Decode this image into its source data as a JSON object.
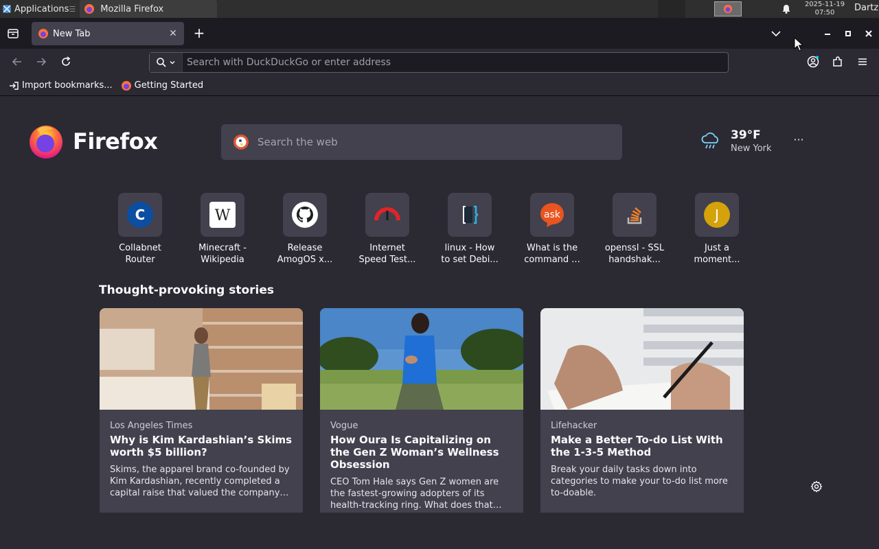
{
  "taskbar": {
    "applications_label": "Applications",
    "separator": "☰",
    "window_title": "Mozilla Firefox",
    "clock_date": "2025-11-19",
    "clock_time": "07:50",
    "user": "Dartz"
  },
  "tabs": [
    {
      "label": "New Tab",
      "active": true
    }
  ],
  "navbar": {
    "url_placeholder": "Search with DuckDuckGo or enter address"
  },
  "bookmarks": [
    {
      "label": "Import bookmarks..."
    },
    {
      "label": "Getting Started"
    }
  ],
  "newtab": {
    "brand": "Firefox",
    "search_placeholder": "Search the web",
    "weather": {
      "temp": "39°F",
      "city": "New York"
    },
    "shortcuts": [
      {
        "line1": "Collabnet",
        "line2": "Router",
        "icon": "collabnet-c-icon"
      },
      {
        "line1": "Minecraft -",
        "line2": "Wikipedia",
        "icon": "wikipedia-w-icon"
      },
      {
        "line1": "Release",
        "line2": "AmogOS x...",
        "icon": "github-icon"
      },
      {
        "line1": "Internet",
        "line2": "Speed Test...",
        "icon": "speedometer-icon"
      },
      {
        "line1": "linux - How",
        "line2": "to set Debi...",
        "icon": "superuser-icon"
      },
      {
        "line1": "What is the",
        "line2": "command ...",
        "icon": "askubuntu-icon"
      },
      {
        "line1": "openssl - SSL",
        "line2": "handshak...",
        "icon": "stackoverflow-icon"
      },
      {
        "line1": "Just a",
        "line2": "moment...",
        "icon": "letter-j-icon"
      }
    ],
    "stories_heading": "Thought-provoking stories",
    "stories": [
      {
        "source": "Los Angeles Times",
        "title": "Why is Kim Kardashian’s Skims worth $5 billion?",
        "excerpt": "Skims, the apparel brand co-founded by Kim Kardashian, recently completed a capital raise that valued the company…"
      },
      {
        "source": "Vogue",
        "title": "How Oura Is Capitalizing on the Gen Z Woman’s Wellness Obsession",
        "excerpt": "CEO Tom Hale says Gen Z women are the fastest-growing adopters of its health-tracking ring. What does that…"
      },
      {
        "source": "Lifehacker",
        "title": "Make a Better To-do List With the 1-3-5 Method",
        "excerpt": "Break your daily tasks down into categories to make your to-do list more to-doable."
      }
    ]
  },
  "colors": {
    "page_bg": "#2b2a33",
    "tabstrip_bg": "#1c1b22",
    "tile_bg": "#42414d",
    "url_border": "#5b5b66"
  }
}
